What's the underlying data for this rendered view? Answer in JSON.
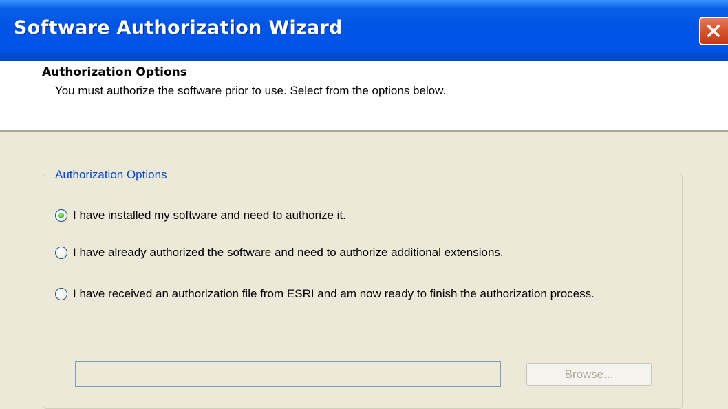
{
  "window": {
    "title": "Software Authorization Wizard",
    "close_icon": "close-icon"
  },
  "header": {
    "title": "Authorization Options",
    "subtitle": "You must authorize the software prior to use. Select from the options below."
  },
  "group": {
    "legend": "Authorization Options",
    "options": [
      {
        "label": "I have installed my software and need to authorize it.",
        "checked": true
      },
      {
        "label": "I have already authorized the software and need to authorize additional extensions.",
        "checked": false
      },
      {
        "label": "I have received an authorization file from ESRI and am now ready to finish the authorization process.",
        "checked": false
      }
    ],
    "file_path": "",
    "browse_label": "Browse..."
  },
  "colors": {
    "titlebar": "#0054e3",
    "dialog_bg": "#ece9d8",
    "legend_text": "#0046d5",
    "close_button": "#d8572f"
  }
}
